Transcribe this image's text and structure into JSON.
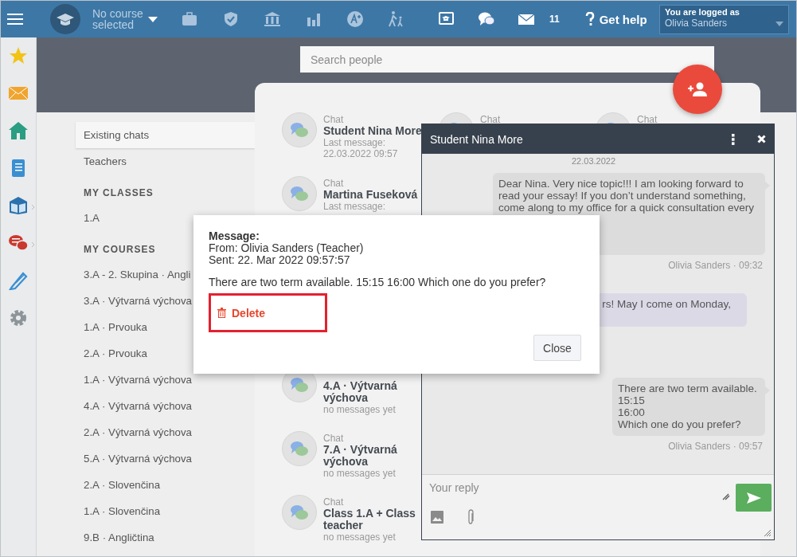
{
  "top_bar": {
    "course": "No course selected",
    "mail_count": "11",
    "help": "Get help",
    "login": {
      "caption": "You are logged as",
      "user": "Olivia Sanders"
    }
  },
  "search": {
    "placeholder": "Search people"
  },
  "sidebar": {
    "items": [
      {
        "label": "Existing chats",
        "selected": true
      },
      {
        "label": "Teachers",
        "selected": false
      }
    ],
    "sections": [
      {
        "heading": "MY CLASSES",
        "items": [
          {
            "label": "1.A",
            "selected": false
          }
        ]
      },
      {
        "heading": "MY COURSES",
        "items": [
          {
            "label": "3.A - 2. Skupina · Angli",
            "selected": false
          },
          {
            "label": "3.A · Výtvarná výchova",
            "selected": false
          },
          {
            "label": "1.A · Prvouka",
            "selected": false
          },
          {
            "label": "2.A · Prvouka",
            "selected": false
          },
          {
            "label": "1.A · Výtvarná výchova",
            "selected": false
          },
          {
            "label": "4.A · Výtvarná výchova",
            "selected": false
          },
          {
            "label": "2.A · Výtvarná výchova",
            "selected": false
          },
          {
            "label": "5.A · Výtvarná výchova",
            "selected": false
          },
          {
            "label": "2.A · Slovenčina",
            "selected": false
          },
          {
            "label": "1.A · Slovenčina",
            "selected": false
          },
          {
            "label": "9.B · Angličtina",
            "selected": false
          }
        ]
      }
    ]
  },
  "chat_list": {
    "columns": [
      [
        {
          "type": "Chat",
          "title": "Student Nina More",
          "subtitle": "Last message:",
          "date": "22.03.2022 09:57"
        },
        {
          "type": "Chat",
          "title": "Martina Fuseková",
          "subtitle": "Last message:"
        },
        {
          "title": "4.A · Výtvarná výchova",
          "subtitle": "no messages yet"
        },
        {
          "type": "Chat",
          "title": "7.A · Výtvarná výchova",
          "subtitle": "no messages yet"
        },
        {
          "type": "Chat",
          "title": "Class 1.A + Class teacher",
          "subtitle": "no messages yet"
        }
      ],
      [
        {
          "type": "Chat"
        }
      ],
      [
        {
          "type": "Chat"
        }
      ]
    ]
  },
  "chat_window": {
    "title": "Student Nina More",
    "date": "22.03.2022",
    "messages": [
      {
        "kind": "sent",
        "text": "Dear Nina. Very nice topic!!! I am looking forward to read your essay! If you don’t understand something, come along to my office for a quick consultation every",
        "meta": "Olivia Sanders · 09:32"
      },
      {
        "kind": "received",
        "text": "rs! May I come on Monday,"
      },
      {
        "kind": "sent",
        "text": "There are two term available.\n15:15\n16:00\nWhich one do you prefer?",
        "meta": "Olivia Sanders · 09:57"
      }
    ],
    "reply": {
      "placeholder": "Your reply"
    }
  },
  "dialog": {
    "heading": "Message:",
    "from": "From: Olivia Sanders (Teacher)",
    "sent": "Sent: 22. Mar 2022 09:57:57",
    "body": "There are two term available. 15:15 16:00 Which one do you prefer?",
    "delete": "Delete",
    "close": "Close",
    "highlighted": true
  }
}
